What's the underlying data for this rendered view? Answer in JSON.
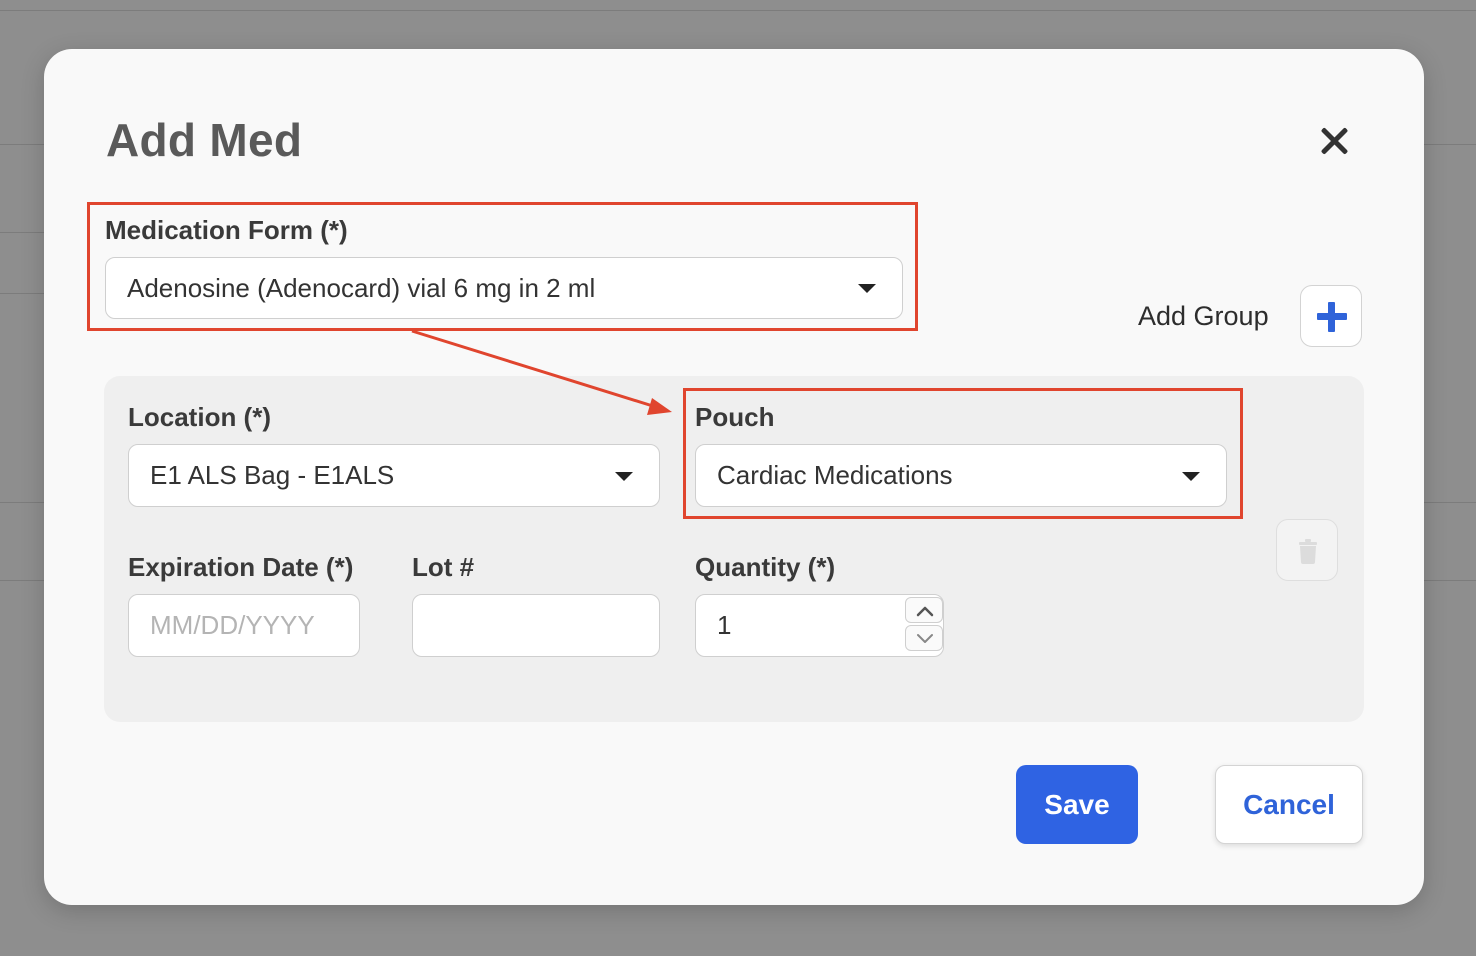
{
  "modal": {
    "title": "Add Med"
  },
  "medication_form": {
    "label": "Medication Form (*)",
    "value": "Adenosine (Adenocard) vial 6 mg in 2 ml"
  },
  "add_group": {
    "label": "Add Group"
  },
  "group": {
    "location": {
      "label": "Location (*)",
      "value": "E1 ALS Bag - E1ALS"
    },
    "pouch": {
      "label": "Pouch",
      "value": "Cardiac Medications"
    },
    "expiration": {
      "label": "Expiration Date (*)",
      "placeholder": "MM/DD/YYYY"
    },
    "lot": {
      "label": "Lot #",
      "value": ""
    },
    "quantity": {
      "label": "Quantity (*)",
      "value": "1"
    }
  },
  "actions": {
    "save_label": "Save",
    "cancel_label": "Cancel"
  },
  "icons": {
    "close": "close-icon",
    "add": "plus-icon",
    "delete": "trash-icon",
    "dropdown": "caret-down-icon",
    "spinner_up": "chevron-up-icon",
    "spinner_down": "chevron-down-icon"
  },
  "colors": {
    "accent": "#2f63e3",
    "annotation": "#e0452e",
    "overlay": "#8e8e8e"
  }
}
